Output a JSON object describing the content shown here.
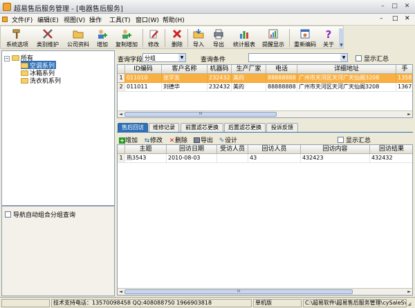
{
  "window": {
    "title": "超易售后服务管理 - [电器售后服务]",
    "minimize": "–",
    "maximize": "□",
    "close": "✕"
  },
  "menu": {
    "file": "文件(F)",
    "edit": "编辑(E)",
    "view": "视图(V)",
    "operate": "操作",
    "tools": "工具(T)",
    "window": "窗口(W)",
    "help": "帮助(H)",
    "mdi_min": "–",
    "mdi_max": "□",
    "mdi_close": "✕"
  },
  "toolbar": {
    "system_options": "系统选项",
    "category_maintain": "类别维护",
    "company_info": "公司资料",
    "add": "增加",
    "copy_add": "复制增加",
    "modify": "修改",
    "delete": "删除",
    "import": "导入",
    "export": "导出",
    "stats_report": "统计报表",
    "reminder": "提醒显示",
    "recode": "重新编码",
    "about": "关于"
  },
  "tree": {
    "root": "所有",
    "items": [
      "空调系列",
      "冰箱系列",
      "洗衣机系列"
    ]
  },
  "left_options": {
    "nav_auto_group": "导航自动组合分组查询"
  },
  "query": {
    "field_label": "查询字段",
    "field_value": "分组",
    "condition_label": "查询条件",
    "condition_value": "",
    "show_summary": "显示汇总"
  },
  "customers": {
    "columns": [
      "ID编码",
      "客户名称",
      "机器码",
      "生产厂家",
      "电话",
      "详细地址",
      "手"
    ],
    "rows": [
      {
        "num": "1",
        "id": "011010",
        "name": "张学友",
        "machine": "232432",
        "maker": "美的",
        "phone": "88888888",
        "address": "广州市天河区天河广天仙阁3208",
        "mobile": "13588"
      },
      {
        "num": "2",
        "id": "011011",
        "name": "刘德华",
        "machine": "232432",
        "maker": "美的",
        "phone": "88888888",
        "address": "广州市天河区天河广天仙阁3208",
        "mobile": "13677"
      }
    ]
  },
  "tabs": [
    "售后回访",
    "维修记录",
    "前置滤芯更换",
    "后置滤芯更换",
    "投诉反馈"
  ],
  "detail_toolbar": {
    "add": "增加",
    "modify": "修改",
    "delete": "删除",
    "export": "导出",
    "design": "设计",
    "show_summary": "显示汇总"
  },
  "visits": {
    "columns": [
      "主题",
      "回访日期",
      "受访人员",
      "回访人员",
      "回访内容",
      "回访结果"
    ],
    "rows": [
      {
        "num": "1",
        "subject": "热3543",
        "date": "2010-08-03",
        "visitee": "",
        "visitor": "43",
        "content": "432423",
        "result": "432432"
      }
    ]
  },
  "status": {
    "support": "技术支持电话：13570098458 QQ:408088750 1966903818",
    "mode": "单机版",
    "path": "C:\\超易软件\\超易售后服务管理\\cySaleSvr"
  },
  "colors": {
    "selected_row": "#F9B043",
    "active_tab": "#2F70B8",
    "window_bg": "#ECE9D8"
  }
}
